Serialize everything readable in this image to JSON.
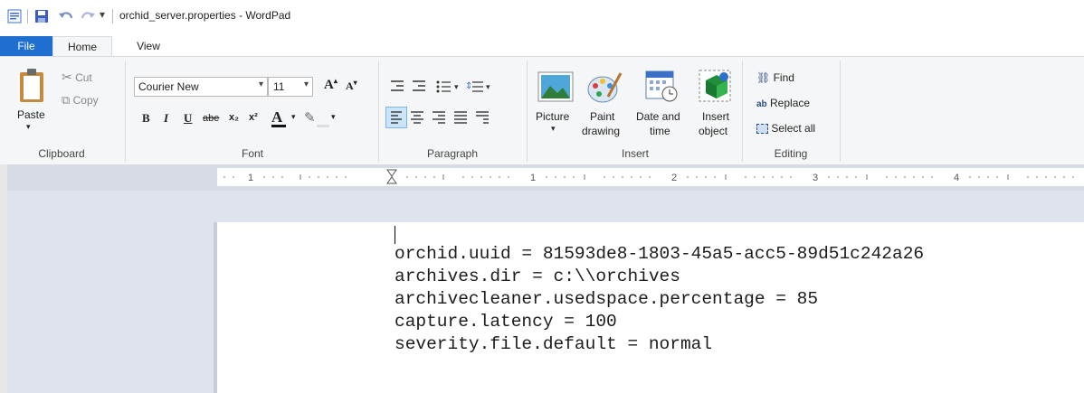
{
  "window": {
    "title": "orchid_server.properties - WordPad"
  },
  "ribbon_tabs": {
    "file": "File",
    "home": "Home",
    "view": "View"
  },
  "clipboard": {
    "paste": "Paste",
    "cut": "Cut",
    "copy": "Copy",
    "label": "Clipboard"
  },
  "font": {
    "family": "Courier New",
    "size": "11",
    "label": "Font",
    "bold": "B",
    "italic": "I",
    "underline": "U",
    "strikethrough": "abe",
    "subscript": "x₂",
    "superscript": "x²",
    "grow": "A",
    "shrink": "A",
    "color_a": "A"
  },
  "paragraph": {
    "label": "Paragraph"
  },
  "insert": {
    "picture": "Picture",
    "paint_drawing_1": "Paint",
    "paint_drawing_2": "drawing",
    "date_time_1": "Date and",
    "date_time_2": "time",
    "insert_object_1": "Insert",
    "insert_object_2": "object",
    "label": "Insert"
  },
  "editing": {
    "find": "Find",
    "replace": "Replace",
    "select_all": "Select all",
    "label": "Editing"
  },
  "ruler": {
    "marks": [
      "1",
      "1",
      "2",
      "3",
      "4"
    ]
  },
  "document": {
    "lines": [
      "orchid.uuid = 81593de8-1803-45a5-acc5-89d51c242a26",
      "archives.dir = c:\\\\orchives",
      "archivecleaner.usedspace.percentage = 85",
      "capture.latency = 100",
      "severity.file.default = normal"
    ]
  },
  "colors": {
    "file_tab": "#1e6fd0",
    "ribbon_bg": "#f5f6f7",
    "doc_bg": "#dee3ec",
    "save_icon": "#3b5fbf"
  }
}
